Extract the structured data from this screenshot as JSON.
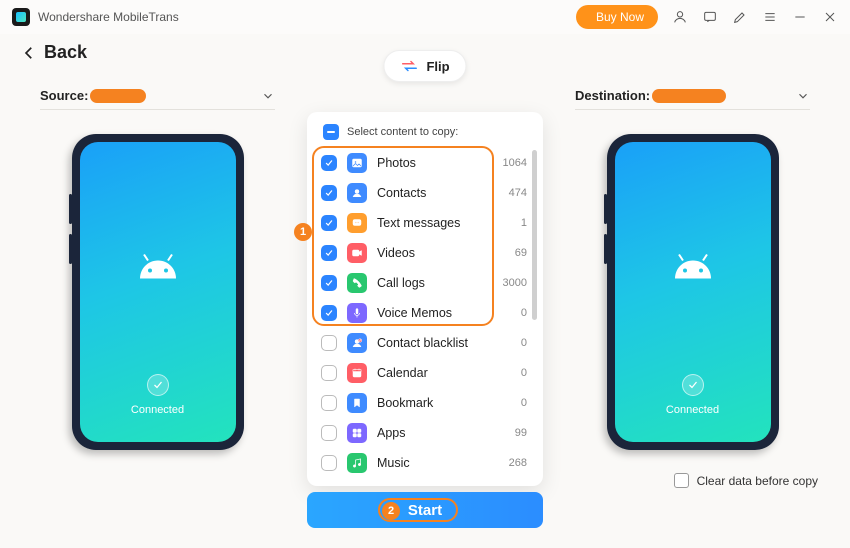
{
  "titlebar": {
    "app_name": "Wondershare MobileTrans",
    "buy_label": "Buy Now"
  },
  "back_label": "Back",
  "flip_label": "Flip",
  "source": {
    "label": "Source:"
  },
  "destination": {
    "label": "Destination:"
  },
  "phone_status": "Connected",
  "panel": {
    "select_label": "Select content to copy:",
    "items": [
      {
        "label": "Photos",
        "count": 1064,
        "checked": true,
        "icon": "photos",
        "color": "#3f8bff"
      },
      {
        "label": "Contacts",
        "count": 474,
        "checked": true,
        "icon": "contacts",
        "color": "#3f8bff"
      },
      {
        "label": "Text messages",
        "count": 1,
        "checked": true,
        "icon": "messages",
        "color": "#ff9e2e"
      },
      {
        "label": "Videos",
        "count": 69,
        "checked": true,
        "icon": "videos",
        "color": "#ff5e66"
      },
      {
        "label": "Call logs",
        "count": 3000,
        "checked": true,
        "icon": "calllogs",
        "color": "#29c76f"
      },
      {
        "label": "Voice Memos",
        "count": 0,
        "checked": true,
        "icon": "voice",
        "color": "#7d68ff"
      },
      {
        "label": "Contact blacklist",
        "count": 0,
        "checked": false,
        "icon": "blacklist",
        "color": "#3f8bff"
      },
      {
        "label": "Calendar",
        "count": 0,
        "checked": false,
        "icon": "calendar",
        "color": "#ff5e66"
      },
      {
        "label": "Bookmark",
        "count": 0,
        "checked": false,
        "icon": "bookmark",
        "color": "#3f8bff"
      },
      {
        "label": "Apps",
        "count": 99,
        "checked": false,
        "icon": "apps",
        "color": "#7d68ff"
      },
      {
        "label": "Music",
        "count": 268,
        "checked": false,
        "icon": "music",
        "color": "#29c76f"
      }
    ]
  },
  "start_label": "Start",
  "clear_label": "Clear data before copy",
  "callouts": {
    "one": "1",
    "two": "2"
  },
  "icon_colors": {
    "photos": "#3f8bff",
    "contacts": "#3f8bff",
    "messages": "#ff9e2e",
    "videos": "#ff5e66",
    "calllogs": "#29c76f",
    "voice": "#7d68ff",
    "blacklist": "#3f8bff",
    "calendar": "#ff5e66",
    "bookmark": "#3f8bff",
    "apps": "#7d68ff",
    "music": "#29c76f"
  }
}
